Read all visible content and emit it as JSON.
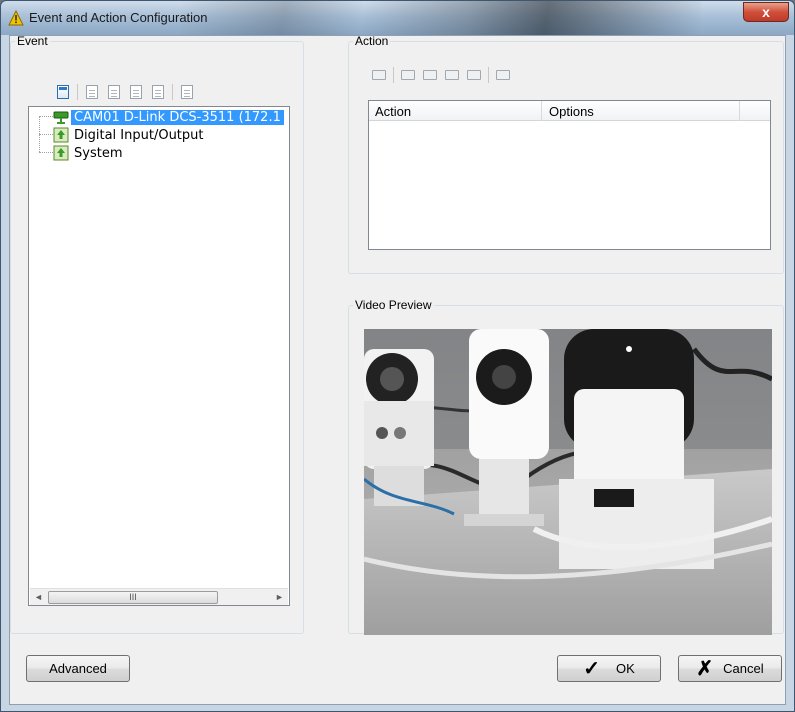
{
  "window": {
    "title": "Event and Action Configuration",
    "close_symbol": "x"
  },
  "event_group": {
    "legend": "Event",
    "toolbar_icons": [
      "new-event-icon",
      "delete-event-icon",
      "copy-event-icon",
      "paste-event-icon",
      "copy-all-icon",
      "properties-icon"
    ],
    "tree": [
      {
        "label": "CAM01 D-Link DCS-3511 (172.1",
        "icon": "camera-icon",
        "selected": true
      },
      {
        "label": "Digital Input/Output",
        "icon": "io-icon",
        "selected": false
      },
      {
        "label": "System",
        "icon": "system-icon",
        "selected": false
      }
    ],
    "scroll_thumb_label": "III",
    "scroll_left": "◄",
    "scroll_right": "►"
  },
  "action_group": {
    "legend": "Action",
    "toolbar_icons": [
      "add-action-icon",
      "edit-action-icon",
      "copy-action-icon",
      "paste-action-icon",
      "move-action-icon",
      "delete-action-icon"
    ],
    "columns": [
      "Action",
      "Options"
    ]
  },
  "video_group": {
    "legend": "Video Preview"
  },
  "buttons": {
    "advanced": "Advanced",
    "ok": "OK",
    "ok_glyph": "✓",
    "cancel": "Cancel",
    "cancel_glyph": "✗"
  },
  "colors": {
    "selection": "#3399ff",
    "title_gradient_top": "#cfdcea",
    "close_red": "#c0392b"
  }
}
